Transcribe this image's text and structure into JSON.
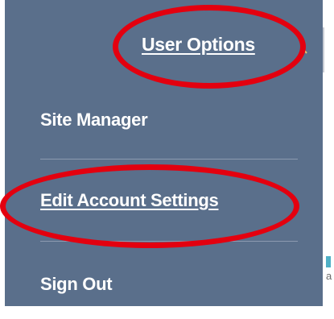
{
  "header": {
    "user_options_label": "User Options",
    "caret_icon": "chevron-up-icon"
  },
  "menu": {
    "items": [
      {
        "label": "Site Manager"
      },
      {
        "label": "Edit Account Settings"
      },
      {
        "label": "Sign Out"
      }
    ]
  },
  "peek": {
    "text": "a"
  },
  "colors": {
    "panel_bg": "#5a6f8b",
    "text": "#ffffff",
    "annotation": "#e3000f"
  }
}
